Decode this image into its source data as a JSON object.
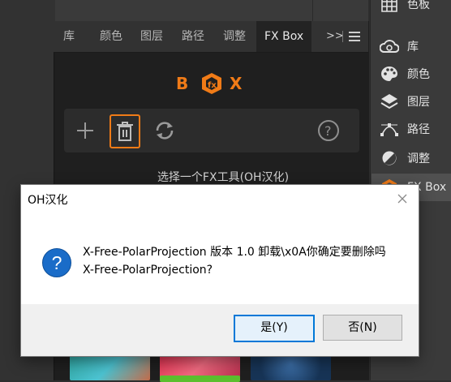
{
  "panel": {
    "tabs": [
      "库",
      "颜色",
      "图层",
      "路径",
      "调整",
      "FX Box"
    ],
    "active_tab": "FX Box",
    "more_label": ">>",
    "subtitle": "选择一个FX工具(OH汉化)"
  },
  "toolbar": {
    "add_icon": "plus-icon",
    "delete_icon": "trash-icon",
    "refresh_icon": "refresh-icon",
    "help_icon": "help-icon"
  },
  "sidebar": {
    "items": [
      {
        "label": "色板",
        "icon": "swatches-icon"
      },
      {
        "label": "库",
        "icon": "libraries-icon"
      },
      {
        "label": "颜色",
        "icon": "color-palette-icon"
      },
      {
        "label": "图层",
        "icon": "layers-icon"
      },
      {
        "label": "路径",
        "icon": "paths-icon"
      },
      {
        "label": "调整",
        "icon": "adjustments-icon"
      },
      {
        "label": "FX Box",
        "icon": "fxbox-icon"
      }
    ]
  },
  "dialog": {
    "title": "OH汉化",
    "message_line1": "X-Free-PolarProjection 版本 1.0 卸载\\x0A你确定要删除吗",
    "message_line2": "X-Free-PolarProjection?",
    "yes_label": "是(Y)",
    "no_label": "否(N)"
  },
  "colors": {
    "accent": "#f07b17",
    "dialog_primary": "#0078d7",
    "panel_bg": "#1f1f1f"
  }
}
